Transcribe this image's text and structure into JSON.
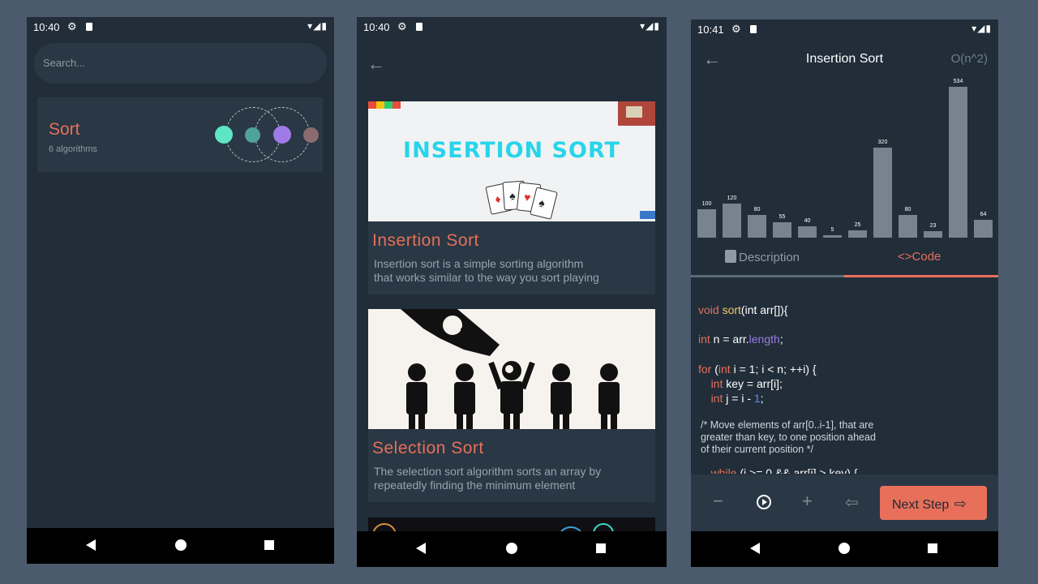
{
  "phone1": {
    "time": "10:40",
    "search_placeholder": "Search...",
    "category": {
      "title": "Sort",
      "subtitle": "6 algorithms"
    },
    "dot_colors": [
      "#5ee6c4",
      "#4fa39a",
      "#a07ae6",
      "#8a6c70"
    ]
  },
  "phone2": {
    "time": "10:40",
    "cards": [
      {
        "image_text": "INSERTION SORT",
        "title": "Insertion Sort",
        "desc_line1": "Insertion sort is a simple sorting algorithm",
        "desc_line2": "that works similar to the way you sort playing"
      },
      {
        "title": "Selection Sort",
        "desc_line1": "The selection sort algorithm sorts an array by",
        "desc_line2": "repeatedly finding the minimum element"
      }
    ]
  },
  "phone3": {
    "time": "10:41",
    "title": "Insertion Sort",
    "complexity": "O(n^2)",
    "tabs": {
      "description": "Description",
      "code": "Code",
      "active": "code"
    },
    "next_label": "Next Step",
    "colors": {
      "accent": "#e8705b",
      "bar": "#77838f"
    }
  },
  "chart_data": {
    "type": "bar",
    "values": [
      100,
      120,
      80,
      55,
      40,
      5,
      25,
      320,
      80,
      23,
      534,
      64
    ]
  }
}
